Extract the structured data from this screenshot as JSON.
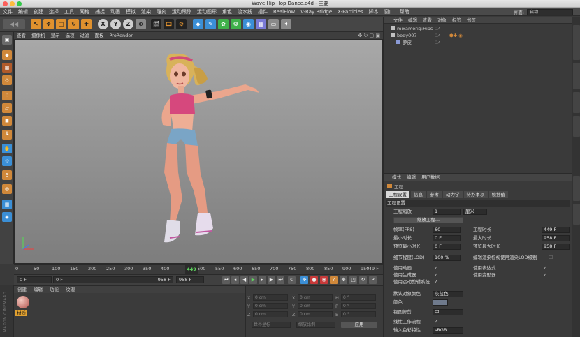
{
  "window": {
    "title": "Wave Hip Hop Dance.c4d - 主要"
  },
  "menu": [
    "文件",
    "编辑",
    "创建",
    "选择",
    "工具",
    "网格",
    "捕捉",
    "动画",
    "模拟",
    "渲染",
    "雕刻",
    "运动跟踪",
    "运动图形",
    "角色",
    "流水线",
    "插件",
    "RealFlow",
    "V-Ray Bridge",
    "X-Particles",
    "脚本",
    "窗口",
    "帮助"
  ],
  "layout": {
    "label": "界面:",
    "value": "启动"
  },
  "toolbar_axes": [
    "X",
    "Y",
    "Z"
  ],
  "viewport_menu": [
    "查看",
    "摄像机",
    "显示",
    "选项",
    "过滤",
    "面板",
    "ProRender"
  ],
  "timeline": {
    "ticks": [
      "0",
      "50",
      "100",
      "150",
      "200",
      "250",
      "300",
      "350",
      "400",
      "449",
      "500",
      "550",
      "600",
      "650",
      "700",
      "750",
      "800",
      "850",
      "900",
      "950"
    ],
    "current": "449",
    "end_label": "449 F"
  },
  "transport": {
    "start": "0 F",
    "current": "0 F",
    "end": "958 F",
    "end2": "958 F"
  },
  "material": {
    "menu": [
      "创建",
      "编辑",
      "功能",
      "纹理"
    ],
    "thumb_label": "材质",
    "brand": "MAXON CINEMA4D"
  },
  "coords": {
    "header": [
      "--",
      "--",
      "--"
    ],
    "rows": [
      {
        "a": "X",
        "av": "0 cm",
        "b": "X",
        "bv": "0 cm",
        "c": "H",
        "cv": "0 °"
      },
      {
        "a": "Y",
        "av": "0 cm",
        "b": "Y",
        "bv": "0 cm",
        "c": "P",
        "cv": "0 °"
      },
      {
        "a": "Z",
        "av": "0 cm",
        "b": "Z",
        "bv": "0 cm",
        "c": "B",
        "cv": "0 °"
      }
    ],
    "mode1": "世界坐标",
    "mode2": "缩放比例",
    "apply": "应用"
  },
  "objects": {
    "menu": [
      "文件",
      "编辑",
      "查看",
      "对象",
      "标签",
      "书签"
    ],
    "items": [
      {
        "name": "mixamorig:Hips",
        "indent": 0
      },
      {
        "name": "body007",
        "indent": 0
      },
      {
        "name": "萝皮",
        "indent": 1
      }
    ]
  },
  "attributes": {
    "menu": [
      "模式",
      "编辑",
      "用户数据"
    ],
    "object_label": "工程",
    "tabs": [
      "工程设置",
      "信息",
      "参考",
      "动力学",
      "待办事项",
      "帧插值"
    ],
    "section": "工程设置",
    "scale_label": "工程缩放",
    "scale_value": "1",
    "scale_unit": "厘米",
    "scale_button": "缩放工程...",
    "fps_label": "帧率(FPS)",
    "fps_value": "60",
    "duration_label": "工程时长",
    "duration_value": "449 F",
    "min_time_label": "最小时长",
    "min_time_value": "0 F",
    "max_time_label": "最大时长",
    "max_time_value": "958 F",
    "preview_min_label": "预览最小时长",
    "preview_min_value": "0 F",
    "preview_max_label": "预览最大时长",
    "preview_max_value": "958 F",
    "lod_label": "细节程度(LOD)",
    "lod_value": "100 %",
    "lod_render_label": "编辑渲染检视使用渲染LOD级别",
    "checks_left": [
      "使用动画",
      "使用生成器",
      "使用运动剪辑系统"
    ],
    "checks_right": [
      "使用表达式",
      "使用变形器"
    ],
    "obj_color_label": "默认对象颜色",
    "obj_color_value": "灰蓝色",
    "color_label": "颜色",
    "color_value": "#6f7a8c",
    "view_clip_label": "视图修剪",
    "view_clip_value": "中",
    "linear_label": "线性工作流程",
    "input_color_label": "输入色彩特性",
    "input_color_value": "sRGB"
  }
}
